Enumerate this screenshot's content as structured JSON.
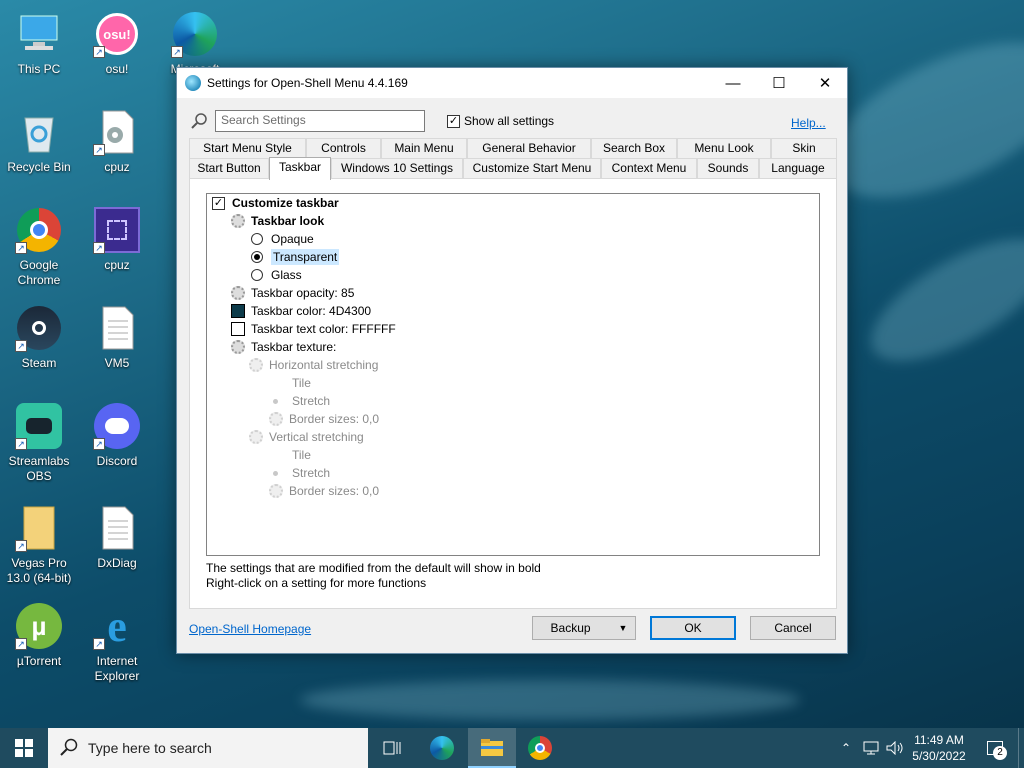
{
  "desktop": {
    "icons": [
      {
        "label": "This PC"
      },
      {
        "label": "osu!"
      },
      {
        "label": "Microsoft"
      },
      {
        "label": "Recycle Bin"
      },
      {
        "label": "cpuz"
      },
      {
        "label": "Google Chrome"
      },
      {
        "label": "cpuz"
      },
      {
        "label": "Steam"
      },
      {
        "label": "VM5"
      },
      {
        "label": "Streamlabs OBS"
      },
      {
        "label": "Discord"
      },
      {
        "label": "Vegas Pro 13.0 (64-bit)"
      },
      {
        "label": "DxDiag"
      },
      {
        "label": "µTorrent"
      },
      {
        "label": "Internet Explorer"
      }
    ]
  },
  "window": {
    "title": "Settings for Open-Shell Menu 4.4.169",
    "search_placeholder": "Search Settings",
    "show_all_label": "Show all settings",
    "help_label": "Help...",
    "tabs_row1": [
      "Start Menu Style",
      "Controls",
      "Main Menu",
      "General Behavior",
      "Search Box",
      "Menu Look",
      "Skin"
    ],
    "tabs_row2": [
      "Start Button",
      "Taskbar",
      "Windows 10 Settings",
      "Customize Start Menu",
      "Context Menu",
      "Sounds",
      "Language"
    ],
    "active_tab": "Taskbar",
    "tree": {
      "customize": "Customize taskbar",
      "look": "Taskbar look",
      "opaque": "Opaque",
      "transparent": "Transparent",
      "glass": "Glass",
      "opacity": "Taskbar opacity: 85",
      "color": "Taskbar color: 4D4300",
      "text_color": "Taskbar text color: FFFFFF",
      "texture": "Taskbar texture:",
      "h_stretch": "Horizontal stretching",
      "h_tile": "Tile",
      "h_stretch_opt": "Stretch",
      "h_border": "Border sizes: 0,0",
      "v_stretch": "Vertical stretching",
      "v_tile": "Tile",
      "v_stretch_opt": "Stretch",
      "v_border": "Border sizes: 0,0"
    },
    "colors": {
      "taskbar_swatch": "#0d3b4a",
      "text_swatch": "#ffffff"
    },
    "note1": "The settings that are modified from the default will show in bold",
    "note2": "Right-click on a setting for more functions",
    "homepage_link": "Open-Shell Homepage",
    "backup_label": "Backup",
    "ok_label": "OK",
    "cancel_label": "Cancel"
  },
  "taskbar": {
    "search_placeholder": "Type here to search",
    "time": "11:49 AM",
    "date": "5/30/2022",
    "notification_count": "2"
  }
}
